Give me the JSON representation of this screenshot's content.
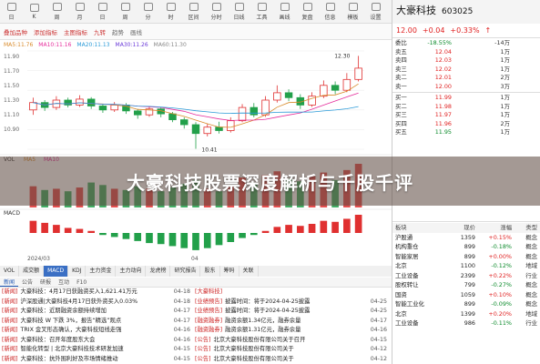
{
  "topbar": {
    "buttons": [
      "日",
      "K",
      "周",
      "月",
      "日",
      "周",
      "分",
      "时",
      "区间",
      "分时",
      "日线",
      "工具",
      "画线",
      "复盘",
      "信息",
      "模板",
      "设置"
    ]
  },
  "toolbar2": {
    "items": [
      "叠加品种",
      "添加指标",
      "主图指标",
      "九转",
      "趋势",
      "画线"
    ]
  },
  "chart": {
    "ma_labels": [
      "MA5:11.76",
      "MA10:11.16",
      "MA20:11.13",
      "MA30:11.26",
      "MA60:11.30"
    ],
    "ma_colors": [
      "#d88a2a",
      "#e52a9a",
      "#2a9ad8",
      "#6a3ad8",
      "#888888"
    ],
    "y_ticks": [
      "11.90",
      "11.70",
      "11.50",
      "11.30",
      "11.10",
      "10.90"
    ],
    "high_label": "12.30",
    "low_label": "10.41",
    "vol_labels": [
      "VOL",
      "MA5",
      "MA10"
    ],
    "macd_label": "MACD",
    "date_left": "2024/03",
    "date_mid": "04"
  },
  "chart_data": {
    "type": "candlestick",
    "candles": [
      {
        "o": 11.2,
        "c": 11.35,
        "h": 11.45,
        "l": 11.1
      },
      {
        "o": 11.35,
        "c": 11.25,
        "h": 11.4,
        "l": 11.18
      },
      {
        "o": 11.25,
        "c": 11.4,
        "h": 11.48,
        "l": 11.2
      },
      {
        "o": 11.4,
        "c": 11.3,
        "h": 11.45,
        "l": 11.25
      },
      {
        "o": 11.3,
        "c": 11.42,
        "h": 11.5,
        "l": 11.26
      },
      {
        "o": 11.42,
        "c": 11.28,
        "h": 11.46,
        "l": 11.22
      },
      {
        "o": 11.28,
        "c": 11.2,
        "h": 11.32,
        "l": 11.14
      },
      {
        "o": 11.2,
        "c": 11.3,
        "h": 11.36,
        "l": 11.16
      },
      {
        "o": 11.3,
        "c": 11.18,
        "h": 11.34,
        "l": 11.12
      },
      {
        "o": 11.18,
        "c": 11.1,
        "h": 11.22,
        "l": 11.02
      },
      {
        "o": 11.1,
        "c": 11.22,
        "h": 11.28,
        "l": 11.06
      },
      {
        "o": 11.22,
        "c": 11.12,
        "h": 11.26,
        "l": 11.05
      },
      {
        "o": 11.12,
        "c": 11.0,
        "h": 11.16,
        "l": 10.95
      },
      {
        "o": 11.0,
        "c": 10.9,
        "h": 11.05,
        "l": 10.82
      },
      {
        "o": 10.9,
        "c": 10.72,
        "h": 10.95,
        "l": 10.41
      },
      {
        "o": 10.72,
        "c": 10.85,
        "h": 10.92,
        "l": 10.66
      },
      {
        "o": 10.85,
        "c": 10.78,
        "h": 10.96,
        "l": 10.72
      },
      {
        "o": 10.78,
        "c": 10.98,
        "h": 11.05,
        "l": 10.74
      },
      {
        "o": 10.98,
        "c": 11.25,
        "h": 11.32,
        "l": 10.95
      },
      {
        "o": 11.25,
        "c": 11.1,
        "h": 11.34,
        "l": 11.05
      },
      {
        "o": 11.1,
        "c": 11.4,
        "h": 11.48,
        "l": 11.06
      },
      {
        "o": 11.4,
        "c": 11.55,
        "h": 11.7,
        "l": 11.35
      },
      {
        "o": 11.55,
        "c": 11.45,
        "h": 11.62,
        "l": 11.38
      },
      {
        "o": 11.45,
        "c": 11.3,
        "h": 11.52,
        "l": 11.22
      },
      {
        "o": 11.3,
        "c": 11.48,
        "h": 11.56,
        "l": 11.26
      },
      {
        "o": 11.48,
        "c": 11.7,
        "h": 11.8,
        "l": 11.44
      },
      {
        "o": 11.7,
        "c": 11.6,
        "h": 11.78,
        "l": 11.52
      },
      {
        "o": 11.6,
        "c": 11.82,
        "h": 11.95,
        "l": 11.56
      },
      {
        "o": 11.82,
        "c": 12.05,
        "h": 12.3,
        "l": 11.78
      }
    ],
    "volume": [
      34,
      28,
      30,
      26,
      32,
      40,
      36,
      30,
      28,
      34,
      30,
      26,
      32,
      38,
      44,
      30,
      26,
      34,
      48,
      40,
      52,
      58,
      46,
      42,
      50,
      56,
      44,
      60,
      70
    ],
    "macd": [
      0.12,
      0.1,
      0.08,
      0.05,
      0.04,
      0.02,
      -0.02,
      -0.04,
      -0.06,
      -0.08,
      -0.1,
      -0.11,
      -0.13,
      -0.15,
      -0.17,
      -0.15,
      -0.12,
      -0.09,
      -0.05,
      -0.02,
      0.02,
      0.06,
      0.08,
      0.07,
      0.09,
      0.12,
      0.11,
      0.14,
      0.18
    ],
    "ylim": [
      10.4,
      12.4
    ]
  },
  "bottom_tabs": [
    "VOL",
    "成交额",
    "MACD",
    "KDJ",
    "主力资金",
    "主力动向",
    "龙虎榜",
    "研究报告",
    "股东",
    "筹码",
    "关联"
  ],
  "news_tabs": [
    "新闻",
    "公告",
    "研报",
    "互动",
    "F10"
  ],
  "news_left": [
    {
      "tag": "[新闻]",
      "title": "大豪科技：4月17日获融资买入1,621.41万元",
      "date": "04-18"
    },
    {
      "tag": "[新闻]",
      "title": "沪深股通|大豪科技4月17日获外资买入0.03%",
      "date": "04-18"
    },
    {
      "tag": "[新闻]",
      "title": "大豪科技：近期融资余额持续增加",
      "date": "04-17"
    },
    {
      "tag": "[新闻]",
      "title": "大豪科技 W 下跌 3%，报告“精选”观点",
      "date": "04-17"
    },
    {
      "tag": "[新闻]",
      "title": "TRIX 金叉形态确认，大豪科技短线走强",
      "date": "04-16"
    },
    {
      "tag": "[新闻]",
      "title": "大豪科技：召开年度股东大会",
      "date": "04-16"
    },
    {
      "tag": "[新闻]",
      "title": "智能化转型 | 北京大豪科技技术研发加速",
      "date": "04-15"
    },
    {
      "tag": "[新闻]",
      "title": "大豪科技：抗外围利好及市场情绪推动",
      "date": "04-15"
    }
  ],
  "news_right": [
    {
      "tag": "[大豪科技]",
      "title": "",
      "date": ""
    },
    {
      "tag": "[业绩预告]",
      "title": "披露时间：将于2024-04-25披露",
      "date": "04-25"
    },
    {
      "tag": "[业绩预告]",
      "title": "披露时间：将于2024-04-25披露",
      "date": "04-25"
    },
    {
      "tag": "[融资融券]",
      "title": "融资余额1.34亿元，融券余量",
      "date": "04-17"
    },
    {
      "tag": "[融资融券]",
      "title": "融资余额1.31亿元，融券余量",
      "date": "04-16"
    },
    {
      "tag": "[公告]",
      "title": "北京大豪科技股份有限公司关于召开",
      "date": "04-15"
    },
    {
      "tag": "[公告]",
      "title": "北京大豪科技股份有限公司关于",
      "date": "04-12"
    },
    {
      "tag": "[公告]",
      "title": "北京大豪科技股份有限公司关于",
      "date": "04-12"
    }
  ],
  "stock": {
    "name": "大豪科技",
    "code": "603025",
    "price": "12.00",
    "change": "+0.04",
    "pct": "+0.33%",
    "rise_label": "↑"
  },
  "quote_rows": [
    {
      "c1": "委比",
      "c2": "-18.55%",
      "c3": "",
      "c4": "-14万",
      "c5": ""
    },
    {
      "c1": "卖五",
      "c2": "12.04",
      "c3": "",
      "c4": "1万",
      "c5": ""
    },
    {
      "c1": "卖四",
      "c2": "12.03",
      "c3": "",
      "c4": "1万",
      "c5": ""
    },
    {
      "c1": "卖三",
      "c2": "12.02",
      "c3": "",
      "c4": "1万",
      "c5": ""
    },
    {
      "c1": "卖二",
      "c2": "12.01",
      "c3": "",
      "c4": "2万",
      "c5": ""
    },
    {
      "c1": "卖一",
      "c2": "12.00",
      "c3": "",
      "c4": "3万",
      "c5": ""
    },
    {
      "c1": "买一",
      "c2": "11.99",
      "c3": "",
      "c4": "1万",
      "c5": ""
    },
    {
      "c1": "买二",
      "c2": "11.98",
      "c3": "",
      "c4": "1万",
      "c5": ""
    },
    {
      "c1": "买三",
      "c2": "11.97",
      "c3": "",
      "c4": "1万",
      "c5": ""
    },
    {
      "c1": "买四",
      "c2": "11.96",
      "c3": "",
      "c4": "2万",
      "c5": ""
    },
    {
      "c1": "买五",
      "c2": "11.95",
      "c3": "",
      "c4": "1万",
      "c5": ""
    }
  ],
  "sector_header": {
    "s1": "板块",
    "s2": "现价",
    "s3": "涨幅",
    "s4": "类型"
  },
  "sectors": [
    {
      "s1": "沪股通",
      "s2": "1359",
      "s3": "+0.15%",
      "s4": "概念",
      "up": true
    },
    {
      "s1": "机构重仓",
      "s2": "899",
      "s3": "-0.18%",
      "s4": "概念",
      "up": false
    },
    {
      "s1": "智能家居",
      "s2": "899",
      "s3": "+0.00%",
      "s4": "概念",
      "up": true
    },
    {
      "s1": "北京",
      "s2": "1100",
      "s3": "-0.12%",
      "s4": "地域",
      "up": false
    },
    {
      "s1": "工业设备",
      "s2": "2399",
      "s3": "+0.22%",
      "s4": "行业",
      "up": true
    },
    {
      "s1": "股权转让",
      "s2": "799",
      "s3": "-0.27%",
      "s4": "概念",
      "up": false
    },
    {
      "s1": "国资",
      "s2": "1059",
      "s3": "+0.10%",
      "s4": "概念",
      "up": true
    },
    {
      "s1": "智能工业化",
      "s2": "899",
      "s3": "-0.09%",
      "s4": "概念",
      "up": false
    },
    {
      "s1": "北京",
      "s2": "1399",
      "s3": "+0.20%",
      "s4": "地域",
      "up": true
    },
    {
      "s1": "工业设备",
      "s2": "986",
      "s3": "-0.11%",
      "s4": "行业",
      "up": false
    }
  ],
  "banner": {
    "title": "大豪科技股票深度解析与千股千评"
  }
}
